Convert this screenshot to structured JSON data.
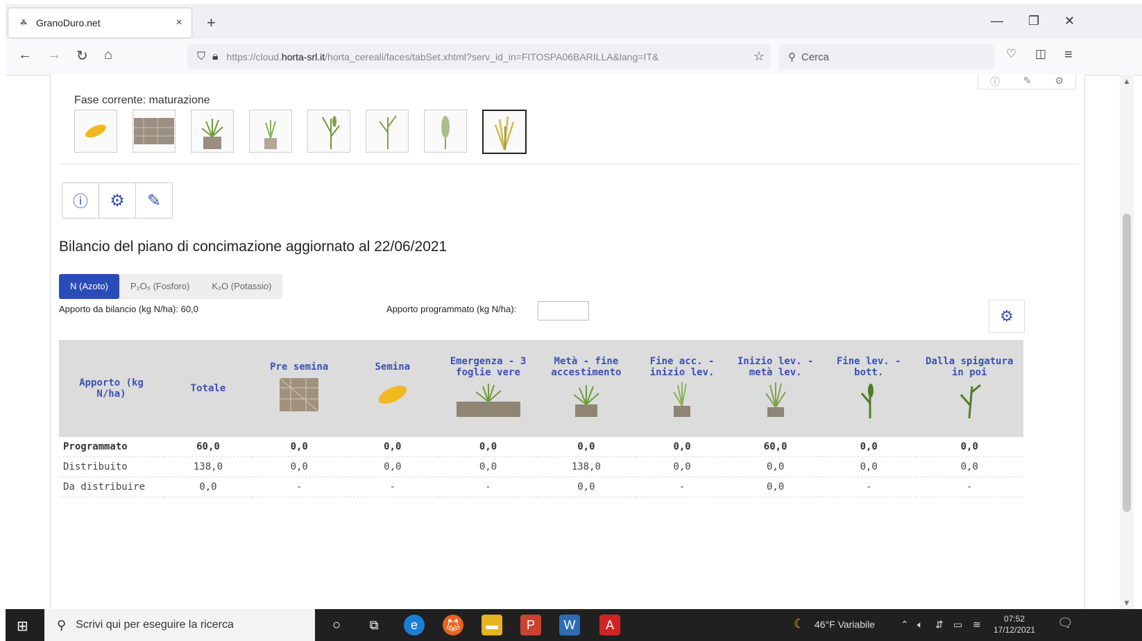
{
  "browser": {
    "tab_title": "GranoDuro.net",
    "new_tab": "+",
    "url_prefix": "https://cloud.",
    "url_domain": "horta-srl.it",
    "url_rest": "/horta_cereali/faces/tabSet.xhtml?serv_id_in=FITOSPA06BARILLA&lang=IT&",
    "search_placeholder": "Cerca"
  },
  "phase": {
    "label": "Fase corrente: maturazione",
    "stages": [
      "seme",
      "pre semina",
      "emergenza",
      "accestimento",
      "levata",
      "botticella",
      "spigatura",
      "maturazione"
    ],
    "selected_index": 7
  },
  "balance": {
    "title": "Bilancio del piano di concimazione aggiornato al 22/06/2021",
    "tabs": [
      {
        "label": "N (Azoto)",
        "active": true
      },
      {
        "label": "P₂O₅ (Fosforo)",
        "active": false
      },
      {
        "label": "K₂O (Potassio)",
        "active": false
      }
    ],
    "apporto_bilancio": "Apporto da bilancio (kg N/ha): 60,0",
    "apporto_programmato": "Apporto programmato (kg N/ha):"
  },
  "table": {
    "headers": [
      "Apporto (kg N/ha)",
      "Totale",
      "Pre semina",
      "Semina",
      "Emergenza - 3 foglie vere",
      "Metà - fine accestimento",
      "Fine acc. - inizio lev.",
      "Inizio lev. - metà lev.",
      "Fine lev. - bott.",
      "Dalla spigatura in poi"
    ],
    "rows": [
      {
        "label": "Programmato",
        "values": [
          "60,0",
          "0,0",
          "0,0",
          "0,0",
          "0,0",
          "0,0",
          "60,0",
          "0,0",
          "0,0"
        ]
      },
      {
        "label": "Distribuito",
        "values": [
          "138,0",
          "0,0",
          "0,0",
          "0,0",
          "138,0",
          "0,0",
          "0,0",
          "0,0",
          "0,0"
        ]
      },
      {
        "label": "Da distribuire",
        "values": [
          "0,0",
          "-",
          "-",
          "-",
          "0,0",
          "-",
          "0,0",
          "-",
          "-"
        ]
      }
    ]
  },
  "taskbar": {
    "search_placeholder": "Scrivi qui per eseguire la ricerca",
    "weather": "46°F  Variabile",
    "time": "07:52",
    "date": "17/12/2021"
  },
  "colors": {
    "accent": "#2a4cb8",
    "header_text": "#3a52b0",
    "header_bg": "#dcdcdc"
  }
}
